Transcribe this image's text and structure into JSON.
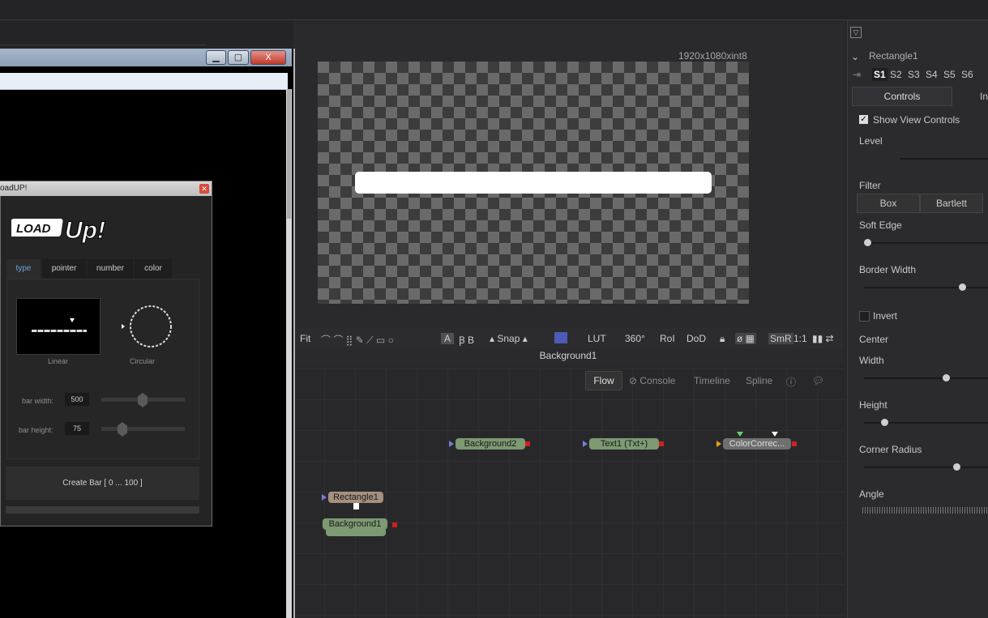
{
  "viewer": {
    "resolution": "1920x1080xint8",
    "node_name": "Background1",
    "toolbar": {
      "fit": "Fit",
      "snap": "Snap",
      "lut": "LUT",
      "rotation": "360°",
      "roi": "RoI",
      "dod": "DoD",
      "smr": "SmR",
      "ratio": "1:1"
    }
  },
  "flow": {
    "tabs": [
      "Flow",
      "Console",
      "Timeline",
      "Spline"
    ],
    "nodes": {
      "background2": "Background2",
      "text1": "Text1  (Txt+)",
      "colorcorrect": "ColorCorrec...",
      "rectangle1": "Rectangle1",
      "background1": "Background1"
    }
  },
  "inspector": {
    "tool_name": "Rectangle1",
    "views": [
      "S1",
      "S2",
      "S3",
      "S4",
      "S5",
      "S6"
    ],
    "tabs": [
      "Controls",
      "In"
    ],
    "show_view_controls": "Show View Controls",
    "level": "Level",
    "filter": "Filter",
    "filter_options": [
      "Box",
      "Bartlett"
    ],
    "soft_edge": "Soft Edge",
    "border_width": "Border Width",
    "invert": "Invert",
    "center": "Center",
    "width": "Width",
    "height": "Height",
    "corner_radius": "Corner Radius",
    "angle": "Angle"
  },
  "loadup": {
    "title": "oadUP!",
    "logo_text": "LOAD Up!",
    "tabs": [
      "type",
      "pointer",
      "number",
      "color"
    ],
    "types": [
      "Linear",
      "Circular"
    ],
    "bar_width_label": "bar width:",
    "bar_width_value": "500",
    "bar_height_label": "bar height:",
    "bar_height_value": "75",
    "create_button": "Create Bar [ 0 ... 100 ]"
  },
  "window_controls": {
    "close": "X"
  }
}
